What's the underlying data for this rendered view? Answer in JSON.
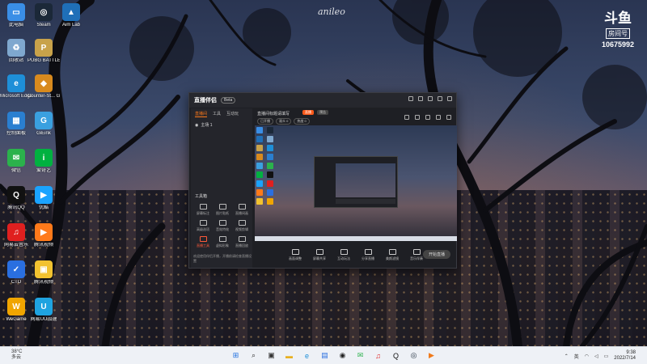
{
  "watermark": "anileo",
  "douyu": {
    "logo": "斗鱼",
    "room_label": "房间号",
    "room_number": "10675992"
  },
  "desktop_icons": [
    {
      "label": "此电脑",
      "color": "#3a8ee6",
      "glyph": "▭",
      "icon": "computer-icon"
    },
    {
      "label": "Steam",
      "color": "#1b2838",
      "glyph": "◎",
      "icon": "steam-icon"
    },
    {
      "label": "Aim Lab",
      "color": "#1f6fb8",
      "glyph": "▲",
      "icon": "aimlab-icon"
    },
    {
      "label": "回收站",
      "color": "#7fa8cf",
      "glyph": "♻",
      "icon": "recycle-bin-icon"
    },
    {
      "label": "PUBG BATTLEGR...",
      "color": "#c8a24a",
      "glyph": "P",
      "icon": "pubg-icon"
    },
    {
      "label": "Microsoft Edge",
      "color": "#1e8fd8",
      "glyph": "e",
      "icon": "edge-icon"
    },
    {
      "label": "Counter-St... Global Off...",
      "color": "#d88a1e",
      "glyph": "◆",
      "icon": "csgo-icon"
    },
    {
      "label": "控制面板",
      "color": "#2a7fd0",
      "glyph": "▦",
      "icon": "control-panel-icon"
    },
    {
      "label": "GiEink",
      "color": "#3aa0e0",
      "glyph": "G",
      "icon": "gieink-icon"
    },
    {
      "label": "微信",
      "color": "#2bb24c",
      "glyph": "✉",
      "icon": "wechat-icon"
    },
    {
      "label": "爱奇艺",
      "color": "#00b140",
      "glyph": "i",
      "icon": "iqiyi-icon"
    },
    {
      "label": "腾讯QQ",
      "color": "#111111",
      "glyph": "Q",
      "icon": "qq-icon"
    },
    {
      "label": "优酷",
      "color": "#1aa3ff",
      "glyph": "▶",
      "icon": "youku-icon"
    },
    {
      "label": "网易云音乐",
      "color": "#e0201f",
      "glyph": "♫",
      "icon": "netease-music-icon"
    },
    {
      "label": "腾讯视频",
      "color": "#ff7a1a",
      "glyph": "▶",
      "icon": "tencent-video-icon"
    },
    {
      "label": "CTD",
      "color": "#2a6fe0",
      "glyph": "✓",
      "icon": "ctd-icon"
    },
    {
      "label": "腾讯视频",
      "color": "#f2c230",
      "glyph": "▣",
      "icon": "folder-icon"
    },
    {
      "label": "WeGame",
      "color": "#f0a500",
      "glyph": "W",
      "icon": "wegame-icon"
    },
    {
      "label": "网易UU加速",
      "color": "#1fa3e0",
      "glyph": "U",
      "icon": "uu-accelerator-icon"
    }
  ],
  "app": {
    "brand": "直播伴侣",
    "version": "Beta",
    "tabs": [
      "直播间",
      "工具",
      "互动玩"
    ],
    "active_tab": "直播间",
    "scene_label": "主场 1",
    "tools_title": "工具箱",
    "tools": [
      {
        "label": "屏幕标注",
        "hot": false
      },
      {
        "label": "图片贴纸",
        "hot": false
      },
      {
        "label": "直播间画",
        "hot": false
      },
      {
        "label": "高级选项",
        "hot": false
      },
      {
        "label": "音效特效",
        "hot": false
      },
      {
        "label": "视频剪辑",
        "hot": false
      },
      {
        "label": "直播工具",
        "hot": true
      },
      {
        "label": "虚拟形象",
        "hot": false
      },
      {
        "label": "直播回放",
        "hot": false
      }
    ],
    "footer_note": "欢迎使用伴侣开播，开播前请检查直播设置",
    "stream_title": "直播间标题请填写",
    "live_tag": "直播",
    "live_tag2": "预告",
    "stats": [
      "已开播",
      "观众 0",
      "热度 0"
    ],
    "controls": [
      "画面调整",
      "屏幕共享",
      "互动玩法",
      "分享直播",
      "美颜滤镜",
      "音乐伴奏"
    ],
    "go_live": "开始直播"
  },
  "taskbar": {
    "weather_temp": "38°C",
    "weather_desc": "多云",
    "apps": [
      {
        "name": "start",
        "glyph": "⊞",
        "color": "#1e6fe0"
      },
      {
        "name": "search",
        "glyph": "⌕",
        "color": "#333333"
      },
      {
        "name": "task-view",
        "glyph": "▣",
        "color": "#333333"
      },
      {
        "name": "file-explorer",
        "glyph": "▬",
        "color": "#e8b020"
      },
      {
        "name": "edge",
        "glyph": "e",
        "color": "#1e8fd8"
      },
      {
        "name": "store",
        "glyph": "▤",
        "color": "#2a6fe0"
      },
      {
        "name": "obs",
        "glyph": "◉",
        "color": "#222222"
      },
      {
        "name": "wechat",
        "glyph": "✉",
        "color": "#2bb24c"
      },
      {
        "name": "netease-music",
        "glyph": "♫",
        "color": "#e0201f"
      },
      {
        "name": "qq",
        "glyph": "Q",
        "color": "#111111"
      },
      {
        "name": "steam",
        "glyph": "◎",
        "color": "#1b2838"
      },
      {
        "name": "live-companion",
        "glyph": "▶",
        "color": "#f07a1a"
      }
    ],
    "lang": "英",
    "time": "9:38",
    "date": "2022/7/14"
  }
}
